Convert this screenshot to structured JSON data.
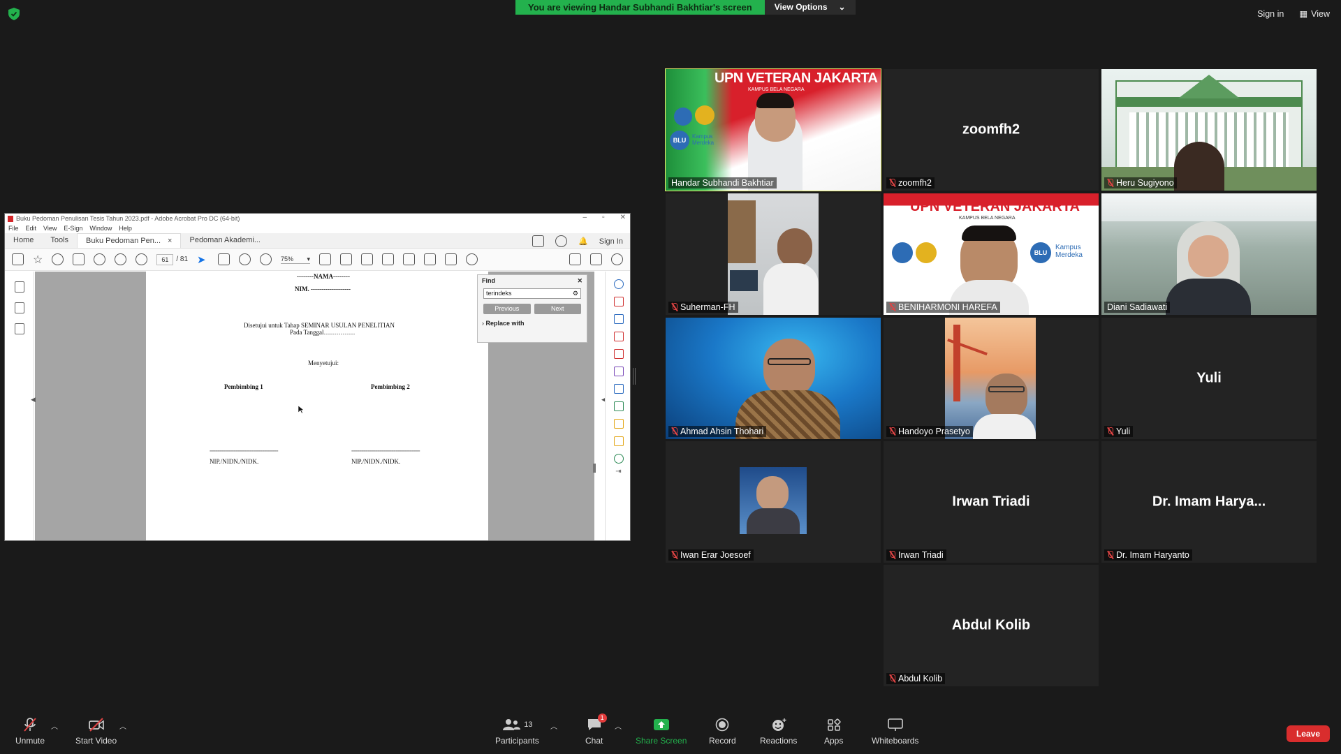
{
  "banner": {
    "viewing_text": "You are viewing Handar Subhandi Bakhtiar's screen",
    "view_options": "View Options"
  },
  "top_right": {
    "sign_in": "Sign in",
    "view": "View"
  },
  "acrobat": {
    "title": "Buku Pedoman Penulisan Tesis Tahun 2023.pdf - Adobe Acrobat Pro DC (64-bit)",
    "menu": [
      "File",
      "Edit",
      "View",
      "E-Sign",
      "Window",
      "Help"
    ],
    "tabs": {
      "home": "Home",
      "tools": "Tools",
      "doc1": "Buku Pedoman Pen...",
      "doc2": "Pedoman Akademi..."
    },
    "sign_in": "Sign In",
    "page_current": "61",
    "page_total": "/ 81",
    "zoom": "75%",
    "page": {
      "nama": "--------NAMA--------",
      "nim": "NIM. -------------------",
      "approve1": "Disetujui untuk Tahap SEMINAR USULAN PENELITIAN",
      "approve2": "Pada Tanggal……………",
      "menyetujui": "Menyetujui:",
      "pembimbing1": "Pembimbing 1",
      "pembimbing2": "Pembimbing 2",
      "sig_line": "==================================",
      "nip1": "NIP./NIDN./NIDK.",
      "nip2": "NIP./NIDN./NIDK."
    },
    "find": {
      "title": "Find",
      "query": "terindeks",
      "previous": "Previous",
      "next": "Next",
      "replace": "Replace with"
    }
  },
  "participants": [
    {
      "name": "Handar Subhandi Bakhtiar",
      "muted": false
    },
    {
      "name": "zoomfh2",
      "display": "zoomfh2",
      "muted": true
    },
    {
      "name": "Heru Sugiyono",
      "muted": true
    },
    {
      "name": "Suherman-FH",
      "muted": true
    },
    {
      "name": "BENIHARMONI HAREFA",
      "muted": true
    },
    {
      "name": "Diani Sadiawati",
      "muted": false
    },
    {
      "name": "Ahmad Ahsin Thohari",
      "muted": true
    },
    {
      "name": "Handoyo Prasetyo",
      "muted": true
    },
    {
      "name": "Yuli",
      "display": "Yuli",
      "muted": true
    },
    {
      "name": "Iwan Erar Joesoef",
      "muted": true
    },
    {
      "name": "Irwan Triadi",
      "display": "Irwan Triadi",
      "muted": true
    },
    {
      "name": "Dr. Imam Haryanto",
      "display": "Dr. Imam Harya...",
      "muted": true
    },
    {
      "name": "Abdul Kolib",
      "display": "Abdul Kolib",
      "muted": true
    }
  ],
  "banner_text": {
    "upn": "UPN VETERAN JAKARTA",
    "kampus": "KAMPUS BELA NEGARA",
    "blu": "BLU",
    "kampus_merdeka": "Kampus Merdeka"
  },
  "toolbar": {
    "unmute": "Unmute",
    "start_video": "Start Video",
    "participants": "Participants",
    "participants_count": "13",
    "chat": "Chat",
    "chat_badge": "1",
    "share_screen": "Share Screen",
    "record": "Record",
    "reactions": "Reactions",
    "apps": "Apps",
    "whiteboards": "Whiteboards",
    "leave": "Leave"
  },
  "colors": {
    "share_green": "#23b14d",
    "leave_red": "#d92d2d",
    "active_speaker": "#e7ef6b",
    "upn_red": "#d8202b"
  }
}
